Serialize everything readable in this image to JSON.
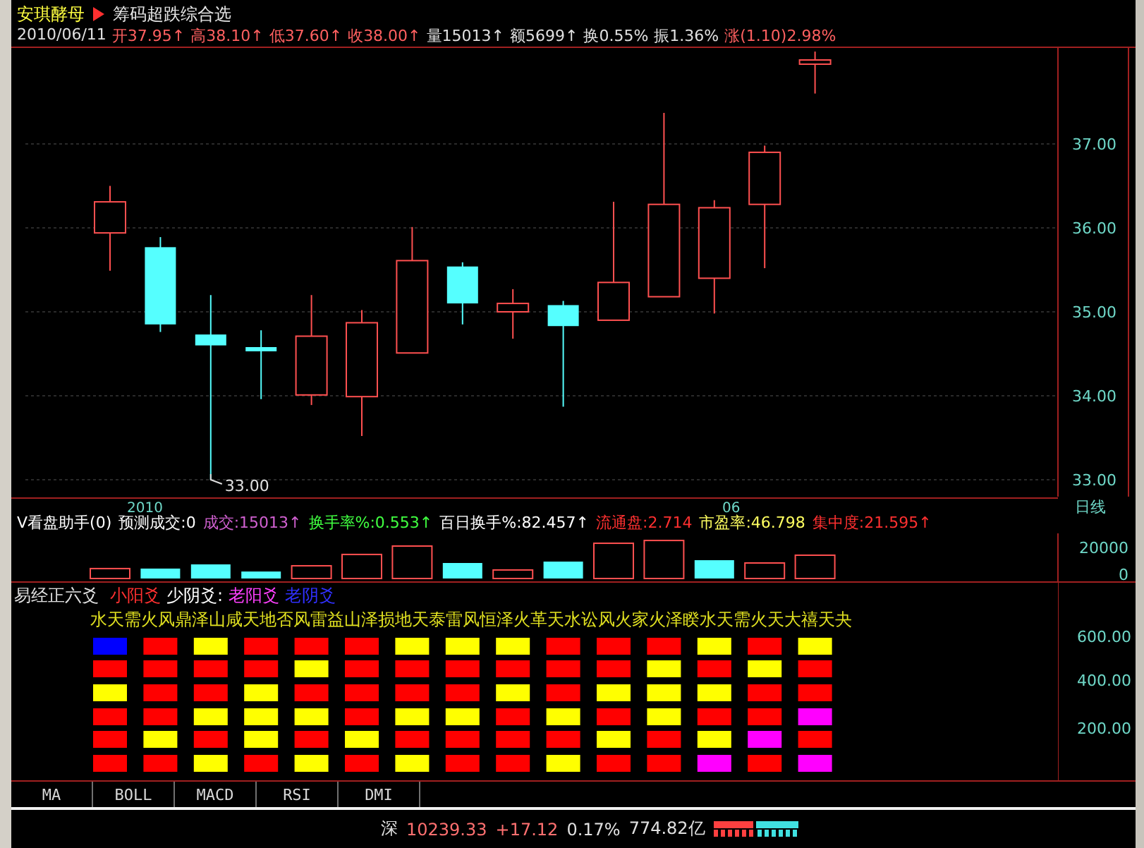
{
  "header": {
    "stock_name": "安琪酵母",
    "formula_name": "筹码超跌综合选",
    "quote": [
      {
        "text": "2010/06/11",
        "color": "#e0e0e0"
      },
      {
        "text": "开37.95↑",
        "color": "#ff6060"
      },
      {
        "text": "高38.10↑",
        "color": "#ff6060"
      },
      {
        "text": "低37.60↑",
        "color": "#ff6060"
      },
      {
        "text": "收38.00↑",
        "color": "#ff6060"
      },
      {
        "text": "量15013↑",
        "color": "#e0e0e0"
      },
      {
        "text": "额5699↑",
        "color": "#e0e0e0"
      },
      {
        "text": "换0.55%",
        "color": "#e0e0e0"
      },
      {
        "text": "振1.36%",
        "color": "#e0e0e0"
      },
      {
        "text": "涨(1.10)2.98%",
        "color": "#ff6060"
      }
    ]
  },
  "price_panel": {
    "axis_labels": [
      "37.00",
      "36.00",
      "35.00",
      "34.00",
      "33.00"
    ],
    "low_label": "33.00",
    "date_labels": [
      "2010",
      "06"
    ]
  },
  "period_label": "日线",
  "volume_panel": {
    "indicators": [
      {
        "text": "V看盘助手(0)",
        "color": "#ffffff"
      },
      {
        "text": "预测成交:0",
        "color": "#ffffff"
      },
      {
        "text": "成交:15013↑",
        "color": "#d060d0"
      },
      {
        "text": "换手率%:0.553↑",
        "color": "#40ff40"
      },
      {
        "text": "百日换手%:82.457↑",
        "color": "#ffffff"
      },
      {
        "text": "流通盘:2.714",
        "color": "#ff3030"
      },
      {
        "text": "市盈率:46.798",
        "color": "#ffff60"
      },
      {
        "text": "集中度:21.595↑",
        "color": "#ff3030"
      }
    ],
    "axis_labels": [
      "20000",
      "0"
    ]
  },
  "yao_panel": {
    "title": "易经正六爻",
    "legend": [
      {
        "text": "小阳爻",
        "color": "#ff3030"
      },
      {
        "text": "少阴爻:",
        "color": "#ffffff"
      },
      {
        "text": "老阳爻",
        "color": "#ff40ff"
      },
      {
        "text": "老阴爻",
        "color": "#3030ff"
      }
    ],
    "hexagrams": "水天需火风鼎泽山咸天地否风雷益山泽损地天泰雷风恒泽火革天水讼风火家火泽睽水天需火天大禧天夬",
    "axis_labels": [
      "600.00",
      "400.00",
      "200.00"
    ],
    "columns": [
      {
        "blocks": [
          {
            "color": "#0000ff"
          },
          {
            "color": "#ff0000"
          },
          {
            "color": "#ffff00"
          },
          {
            "color": "#ff0000"
          },
          {
            "color": "#ff0000"
          },
          {
            "color": "#ff0000"
          }
        ]
      },
      {
        "blocks": [
          {
            "color": "#ff0000"
          },
          {
            "color": "#ff0000"
          },
          {
            "color": "#ff0000"
          },
          {
            "color": "#ff0000"
          },
          {
            "color": "#ffff00"
          },
          {
            "color": "#ff0000"
          }
        ]
      },
      {
        "blocks": [
          {
            "color": "#ffff00"
          },
          {
            "color": "#ff0000"
          },
          {
            "color": "#ff0000"
          },
          {
            "color": "#ffff00"
          },
          {
            "color": "#ff0000"
          },
          {
            "color": "#ffff00"
          }
        ]
      },
      {
        "blocks": [
          {
            "color": "#ff0000"
          },
          {
            "color": "#ff0000"
          },
          {
            "color": "#ffff00"
          },
          {
            "color": "#ffff00"
          },
          {
            "color": "#ffff00"
          },
          {
            "color": "#ff0000"
          }
        ]
      },
      {
        "blocks": [
          {
            "color": "#ff0000"
          },
          {
            "color": "#ffff00"
          },
          {
            "color": "#ff0000"
          },
          {
            "color": "#ffff00"
          },
          {
            "color": "#ff0000"
          },
          {
            "color": "#ffff00"
          }
        ]
      },
      {
        "blocks": [
          {
            "color": "#ff0000"
          },
          {
            "color": "#ff0000"
          },
          {
            "color": "#ff0000"
          },
          {
            "color": "#ff0000"
          },
          {
            "color": "#ffff00"
          },
          {
            "color": "#ff0000"
          }
        ]
      },
      {
        "blocks": [
          {
            "color": "#ffff00"
          },
          {
            "color": "#ff0000"
          },
          {
            "color": "#ff0000"
          },
          {
            "color": "#ffff00"
          },
          {
            "color": "#ff0000"
          },
          {
            "color": "#ffff00"
          }
        ]
      },
      {
        "blocks": [
          {
            "color": "#ffff00"
          },
          {
            "color": "#ff0000"
          },
          {
            "color": "#ff0000"
          },
          {
            "color": "#ffff00"
          },
          {
            "color": "#ff0000"
          },
          {
            "color": "#ff0000"
          }
        ]
      },
      {
        "blocks": [
          {
            "color": "#ffff00"
          },
          {
            "color": "#ff0000"
          },
          {
            "color": "#ffff00"
          },
          {
            "color": "#ff0000"
          },
          {
            "color": "#ff0000"
          },
          {
            "color": "#ff0000"
          }
        ]
      },
      {
        "blocks": [
          {
            "color": "#ff0000"
          },
          {
            "color": "#ff0000"
          },
          {
            "color": "#ff0000"
          },
          {
            "color": "#ffff00"
          },
          {
            "color": "#ff0000"
          },
          {
            "color": "#ffff00"
          }
        ]
      },
      {
        "blocks": [
          {
            "color": "#ff0000"
          },
          {
            "color": "#ff0000"
          },
          {
            "color": "#ffff00"
          },
          {
            "color": "#ff0000"
          },
          {
            "color": "#ffff00"
          },
          {
            "color": "#ff0000"
          }
        ]
      },
      {
        "blocks": [
          {
            "color": "#ff0000"
          },
          {
            "color": "#ffff00"
          },
          {
            "color": "#ffff00"
          },
          {
            "color": "#ffff00"
          },
          {
            "color": "#ff0000"
          },
          {
            "color": "#ff0000"
          }
        ]
      },
      {
        "blocks": [
          {
            "color": "#ffff00"
          },
          {
            "color": "#ff0000"
          },
          {
            "color": "#ffff00"
          },
          {
            "color": "#ff0000"
          },
          {
            "color": "#ffff00"
          },
          {
            "color": "#ff00ff"
          }
        ]
      },
      {
        "blocks": [
          {
            "color": "#ff0000"
          },
          {
            "color": "#ffff00"
          },
          {
            "color": "#ff0000"
          },
          {
            "color": "#ff0000"
          },
          {
            "color": "#ff00ff"
          },
          {
            "color": "#ff0000"
          }
        ]
      },
      {
        "blocks": [
          {
            "color": "#ffff00"
          },
          {
            "color": "#ff0000"
          },
          {
            "color": "#ff0000"
          },
          {
            "color": "#ff00ff"
          },
          {
            "color": "#ff0000"
          },
          {
            "color": "#ff00ff"
          }
        ]
      }
    ]
  },
  "indicator_tabs": [
    {
      "label": "MA"
    },
    {
      "label": "BOLL"
    },
    {
      "label": "MACD"
    },
    {
      "label": "RSI"
    },
    {
      "label": "DMI"
    }
  ],
  "status_bar": {
    "market": "深",
    "index": "10239.33",
    "change": "+17.12",
    "percent": "0.17%",
    "turnover": "774.82亿"
  }
}
